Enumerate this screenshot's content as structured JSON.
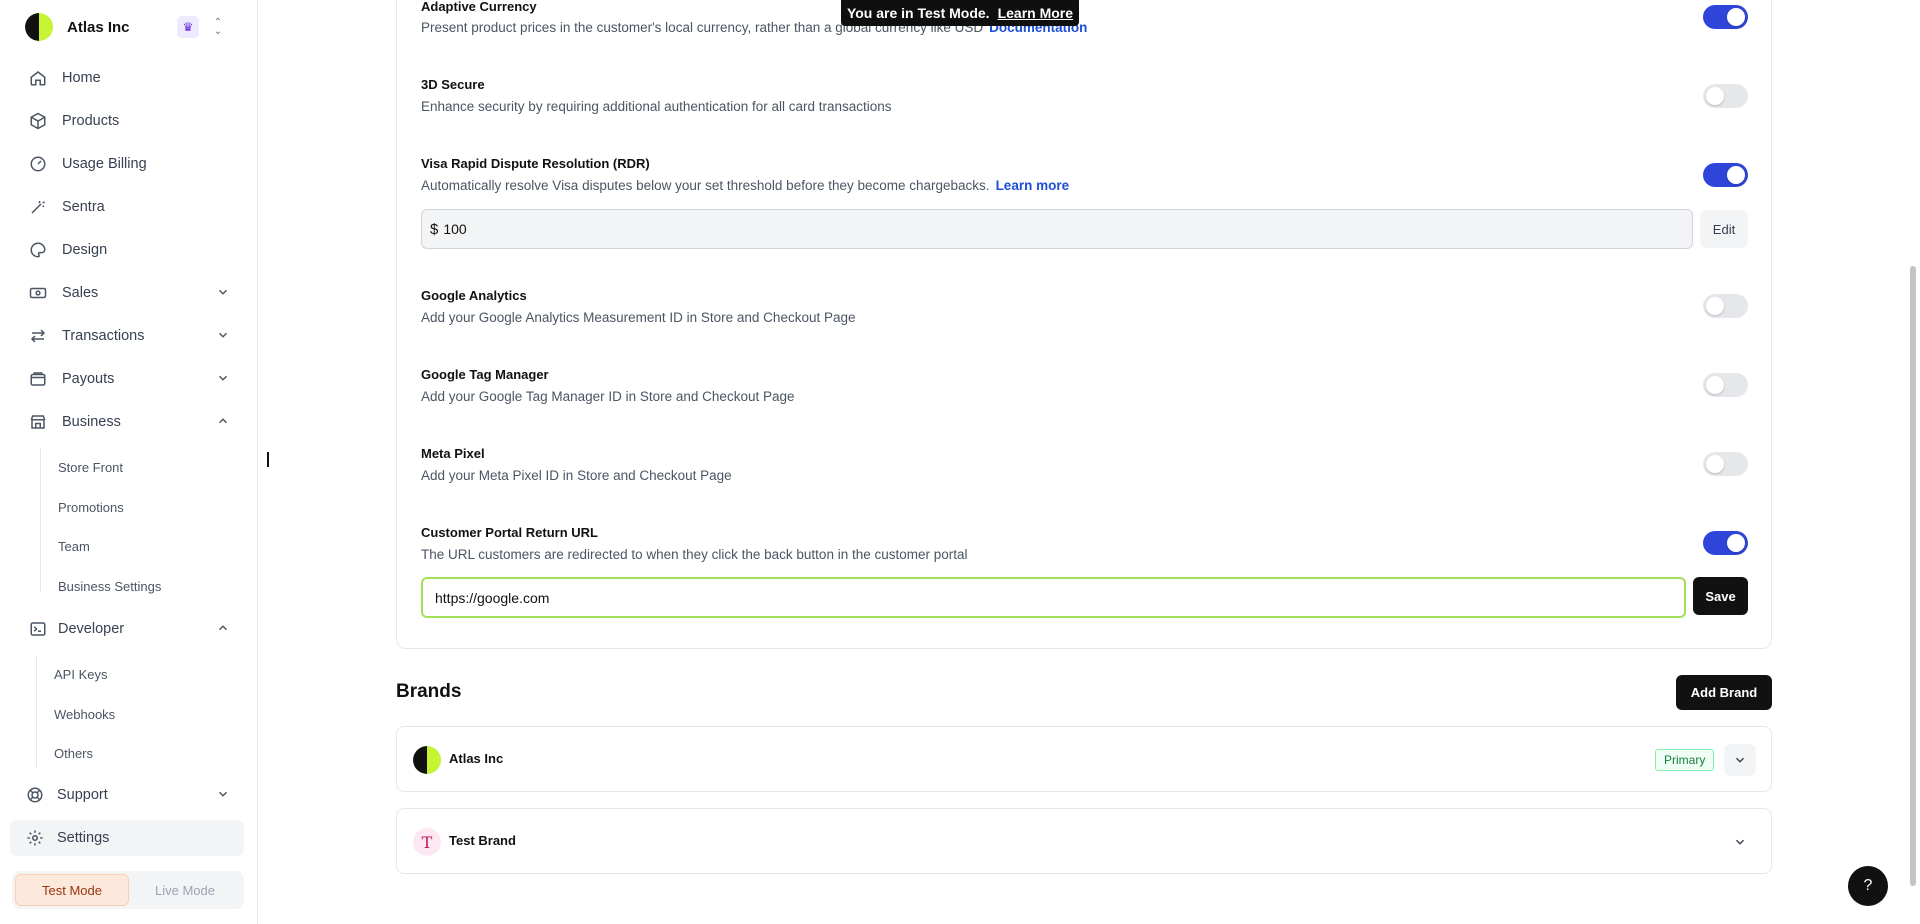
{
  "org": {
    "name": "Atlas Inc"
  },
  "nav": {
    "home": "Home",
    "products": "Products",
    "usage_billing": "Usage Billing",
    "sentra": "Sentra",
    "design": "Design",
    "sales": "Sales",
    "transactions": "Transactions",
    "payouts": "Payouts",
    "business": "Business",
    "business_sub": [
      "Store Front",
      "Promotions",
      "Team",
      "Business Settings"
    ],
    "developer": "Developer",
    "developer_sub": [
      "API Keys",
      "Webhooks",
      "Others"
    ],
    "support": "Support",
    "settings": "Settings"
  },
  "mode": {
    "test": "Test Mode",
    "live": "Live Mode"
  },
  "banner": {
    "text": "You are in Test Mode.",
    "link": "Learn More"
  },
  "settings": {
    "adaptive_currency": {
      "title": "Adaptive Currency",
      "desc": "Present product prices in the customer's local currency, rather than a global currency like USD",
      "link": "Documentation",
      "enabled": true
    },
    "secure_3d": {
      "title": "3D Secure",
      "desc": "Enhance security by requiring additional authentication for all card transactions",
      "enabled": false
    },
    "rdr": {
      "title": "Visa Rapid Dispute Resolution (RDR)",
      "desc": "Automatically resolve Visa disputes below your set threshold before they become chargebacks.",
      "link": "Learn more",
      "enabled": true,
      "currency_symbol": "$",
      "amount": "100",
      "edit_label": "Edit"
    },
    "google_analytics": {
      "title": "Google Analytics",
      "desc": "Add your Google Analytics Measurement ID in Store and Checkout Page",
      "enabled": false
    },
    "google_tag_manager": {
      "title": "Google Tag Manager",
      "desc": "Add your Google Tag Manager ID in Store and Checkout Page",
      "enabled": false
    },
    "meta_pixel": {
      "title": "Meta Pixel",
      "desc": "Add your Meta Pixel ID in Store and Checkout Page",
      "enabled": false
    },
    "portal_return": {
      "title": "Customer Portal Return URL",
      "desc": "The URL customers are redirected to when they click the back button in the customer portal",
      "enabled": true,
      "url": "https://google.com",
      "save_label": "Save"
    }
  },
  "brands": {
    "title": "Brands",
    "add_label": "Add Brand",
    "items": [
      {
        "name": "Atlas Inc",
        "badge": "Primary"
      },
      {
        "name": "Test Brand",
        "initial": "T"
      }
    ]
  },
  "help": {
    "label": "?"
  },
  "colors": {
    "accent": "#2f45d9",
    "brand_lime": "#c6f432",
    "focus_ring": "#a3e05a"
  }
}
